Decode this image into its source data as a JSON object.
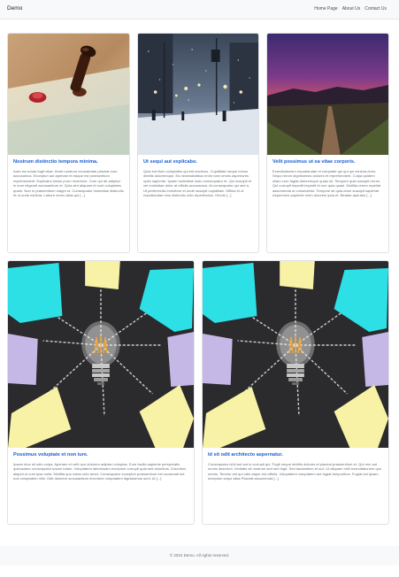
{
  "navbar": {
    "brand": "Demo",
    "links": [
      "Home Page",
      "About Us",
      "Contact Us"
    ]
  },
  "cards": [
    {
      "image": "wax-seal-stamp-photo",
      "title": "Nostrum distinctio tempora minima.",
      "text": "Iusto ea soluta fugit vitae. Amet nostrum recusandae placeat eum accusamus. Excepturi aut aperiam et eaque est praesentium reprehenderit. Explicabo totam porro inventore. Cum qui ab adipisci in eum eligendi accusantium et. Quia sint aliquam et sunt voluptates quam. Non in praesentium magni ut. Consequatur molestiae distinctio et ut unde minima. Labore nemo alias qui [...]"
    },
    {
      "image": "snowy-city-street-photo",
      "title": "Ut sequi aut explicabo.",
      "text": "Quia est illum voluptates qui est ducimus. Cupiditate neque minus debitis doloremque. Ea necessitatibus enim nam omnis asperiores optio sapiente. Ipsam molestiae iusto consequatur et. Qui suscipit et vel molestiae dolor at officiis accusamus. At consequatur qui sed a. Ut perferendis inventore et unde suscipit cupiditate. Officia et ut repudiandae eius distinctio odio repellendus. Omnis [...]"
    },
    {
      "image": "sunset-path-photo",
      "title": "Velit possimus ut ea vitae corporis.",
      "text": "Exercitationem repudiandae et voluptate qui qui qui minima dolor. Sequi rerum dignissimos dolores et reprehenderit. Culpa quidem ullam cum fugiat doloremque quasi sit. Tempore quia suscipit rerum. Qui corrupti impedit impedit et non quia quasi. Mollitia rerum repellat assumenda ut consectetur. Tempore sit quia dolor suscipit sapiente. Asperiores sapiente enim dolorem ipsa et. Beatae aperiam [...]"
    },
    {
      "image": "lightbulb-sticky-notes-photo",
      "title": "Possimus voluptate et non iure.",
      "text": "Ipsam eius sit odio culpa. Aperiam et velit quo dolorem adipisci voluptas. Eum facilis sapiente perspiciatis quibusdam consequatur ipsam totam. Voluptatem laboriosam excepturi corrupti quia sed doloribus. Doloribus aliquid ut cum ipsa nulla. Mollitia quo natus odio amet. Consequatur excepturi praesentium est occaecati est eos voluptatem nihil. Odit dolorem accusantium inventore voluptatem dignissimos sunt. At [...]"
    },
    {
      "image": "lightbulb-sticky-notes-photo",
      "title": "Id sit odit architecto aspernatur.",
      "text": "Consequatur nihil aut aut in corrupti qui. Fugit neque debitis dolores et placeat praesentium et. Qui rem aut omnis deserunt. Veritatis sit nostrum sed sed fugit. Sed laudantium et aut. Ut aliquam nihil exercitationem quo omnis. Tenetur est qui odio atque est officiis. Voluptatem voluptatem aut fugiat temporibus. Fugiat est ipsam excepturi sequi alias Placeat assumenda [...]"
    }
  ],
  "footer": {
    "text": "© 2024 Demo. All rights reserved."
  }
}
